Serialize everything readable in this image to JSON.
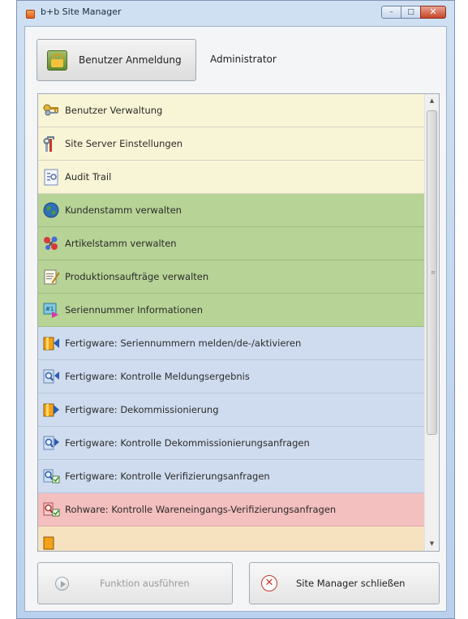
{
  "window": {
    "title": "b+b Site Manager"
  },
  "caption_buttons": {
    "minimize": "–",
    "maximize": "□",
    "close": "✕"
  },
  "header": {
    "login_button": "Benutzer Anmeldung",
    "user": "Administrator"
  },
  "list": {
    "items": [
      {
        "label": "Benutzer Verwaltung",
        "icon": "keys-icon",
        "group": "yellow"
      },
      {
        "label": "Site Server Einstellungen",
        "icon": "tools-icon",
        "group": "yellow"
      },
      {
        "label": "Audit Trail",
        "icon": "audit-icon",
        "group": "yellow"
      },
      {
        "label": "Kundenstamm verwalten",
        "icon": "globe-icon",
        "group": "green"
      },
      {
        "label": "Artikelstamm verwalten",
        "icon": "molecule-icon",
        "group": "green"
      },
      {
        "label": "Produktionsaufträge verwalten",
        "icon": "notepad-icon",
        "group": "green"
      },
      {
        "label": "Seriennummer Informationen",
        "icon": "serial-icon",
        "group": "green"
      },
      {
        "label": "Fertigware: Seriennummern melden/de-/aktivieren",
        "icon": "box-report-icon",
        "group": "blue"
      },
      {
        "label": "Fertigware: Kontrolle Meldungsergebnis",
        "icon": "magnifier-report-icon",
        "group": "blue"
      },
      {
        "label": "Fertigware: Dekommissionierung",
        "icon": "box-decommission-icon",
        "group": "blue"
      },
      {
        "label": "Fertigware: Kontrolle Dekommissionierungsanfragen",
        "icon": "magnifier-decommission-icon",
        "group": "blue"
      },
      {
        "label": "Fertigware: Kontrolle Verifizierungsanfragen",
        "icon": "magnifier-verify-icon",
        "group": "blue"
      },
      {
        "label": "Rohware: Kontrolle Wareneingangs-Verifizierungsanfragen",
        "icon": "magnifier-verify-red-icon",
        "group": "red"
      },
      {
        "label": "",
        "icon": "box-orange-icon",
        "group": "orange"
      }
    ]
  },
  "footer": {
    "run_button": "Funktion ausführen",
    "close_button": "Site Manager schließen"
  },
  "colors": {
    "yellow": "#f8f4d6",
    "green": "#b7d396",
    "blue": "#cfdcef",
    "red": "#f3bfbf"
  }
}
